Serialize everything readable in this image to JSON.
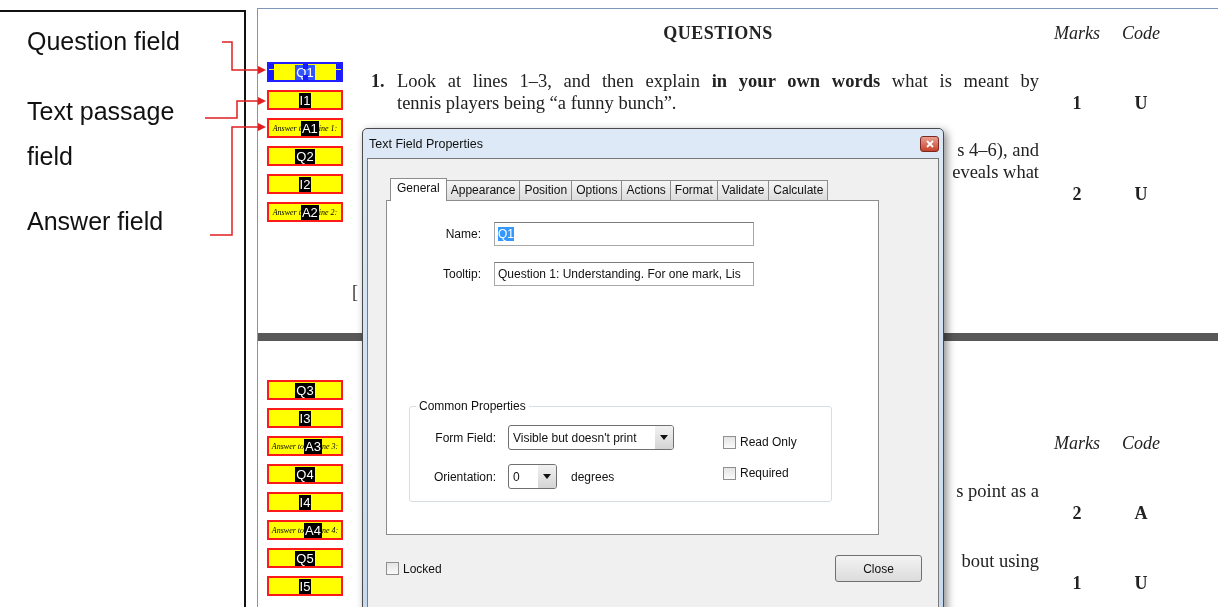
{
  "annotations": [
    {
      "text": "Question field"
    },
    {
      "text": "Text passage field"
    },
    {
      "text": "Answer field"
    }
  ],
  "document": {
    "pages": [
      {
        "heading": "QUESTIONS",
        "column_headers": [
          "Marks",
          "Code"
        ],
        "fields": [
          {
            "kind": "question",
            "label": "Q1",
            "selected": true
          },
          {
            "kind": "passage",
            "label": "I1",
            "selected": false
          },
          {
            "kind": "answer",
            "label": "A1",
            "before": "Answer t",
            "after": "ine 1:",
            "selected": false
          },
          {
            "kind": "question",
            "label": "Q2",
            "selected": false
          },
          {
            "kind": "passage",
            "label": "I2",
            "selected": false
          },
          {
            "kind": "answer",
            "label": "A2",
            "before": "Answer t",
            "after": "ine 2:",
            "selected": false
          }
        ],
        "items": [
          {
            "kind": "full",
            "number": "1.",
            "lines": [
              "Look at lines 1–3, and then explain **in your own words** what is meant by",
              "tennis players being “a funny bunch”."
            ],
            "marks": "1",
            "code": "U"
          },
          {
            "kind": "partial",
            "lines": [
              "s 4–6), and",
              "eveals what"
            ],
            "marks": "2",
            "code": "U"
          }
        ],
        "stray_text": "["
      },
      {
        "column_headers": [
          "Marks",
          "Code"
        ],
        "fields": [
          {
            "kind": "question",
            "label": "Q3",
            "selected": false
          },
          {
            "kind": "passage",
            "label": "I3",
            "selected": false
          },
          {
            "kind": "answer",
            "label": "A3",
            "before": "Answer to",
            "after": "ne 3:",
            "selected": false
          },
          {
            "kind": "question",
            "label": "Q4",
            "selected": false
          },
          {
            "kind": "passage",
            "label": "I4",
            "selected": false
          },
          {
            "kind": "answer",
            "label": "A4",
            "before": "Answer to",
            "after": "ne 4:",
            "selected": false
          },
          {
            "kind": "question",
            "label": "Q5",
            "selected": false
          },
          {
            "kind": "passage",
            "label": "I5",
            "selected": false
          }
        ],
        "items": [
          {
            "kind": "partial",
            "lines": [
              "s point as a"
            ],
            "marks": "2",
            "code": "A"
          },
          {
            "kind": "partial",
            "lines": [
              "bout using"
            ],
            "marks": "1",
            "code": "U"
          }
        ]
      }
    ]
  },
  "dialog": {
    "title": "Text Field Properties",
    "tabs": [
      {
        "label": "General",
        "selected": true
      },
      {
        "label": "Appearance",
        "selected": false
      },
      {
        "label": "Position",
        "selected": false
      },
      {
        "label": "Options",
        "selected": false
      },
      {
        "label": "Actions",
        "selected": false
      },
      {
        "label": "Format",
        "selected": false
      },
      {
        "label": "Validate",
        "selected": false
      },
      {
        "label": "Calculate",
        "selected": false
      }
    ],
    "fields": [
      {
        "label": "Name:",
        "value": "Q1",
        "text_selected": true
      },
      {
        "label": "Tooltip:",
        "value": "Question 1: Understanding. For one mark, Lis",
        "text_selected": false
      }
    ],
    "group": {
      "title": "Common Properties",
      "selects": [
        {
          "label": "Form Field:",
          "value": "Visible but doesn't print"
        },
        {
          "label": "Orientation:",
          "value": "0",
          "unit": "degrees"
        }
      ],
      "checkboxes": [
        {
          "label": "Read Only",
          "checked": false
        },
        {
          "label": "Required",
          "checked": false
        }
      ]
    },
    "locked": {
      "label": "Locked",
      "checked": false
    },
    "close_button": "Close"
  }
}
